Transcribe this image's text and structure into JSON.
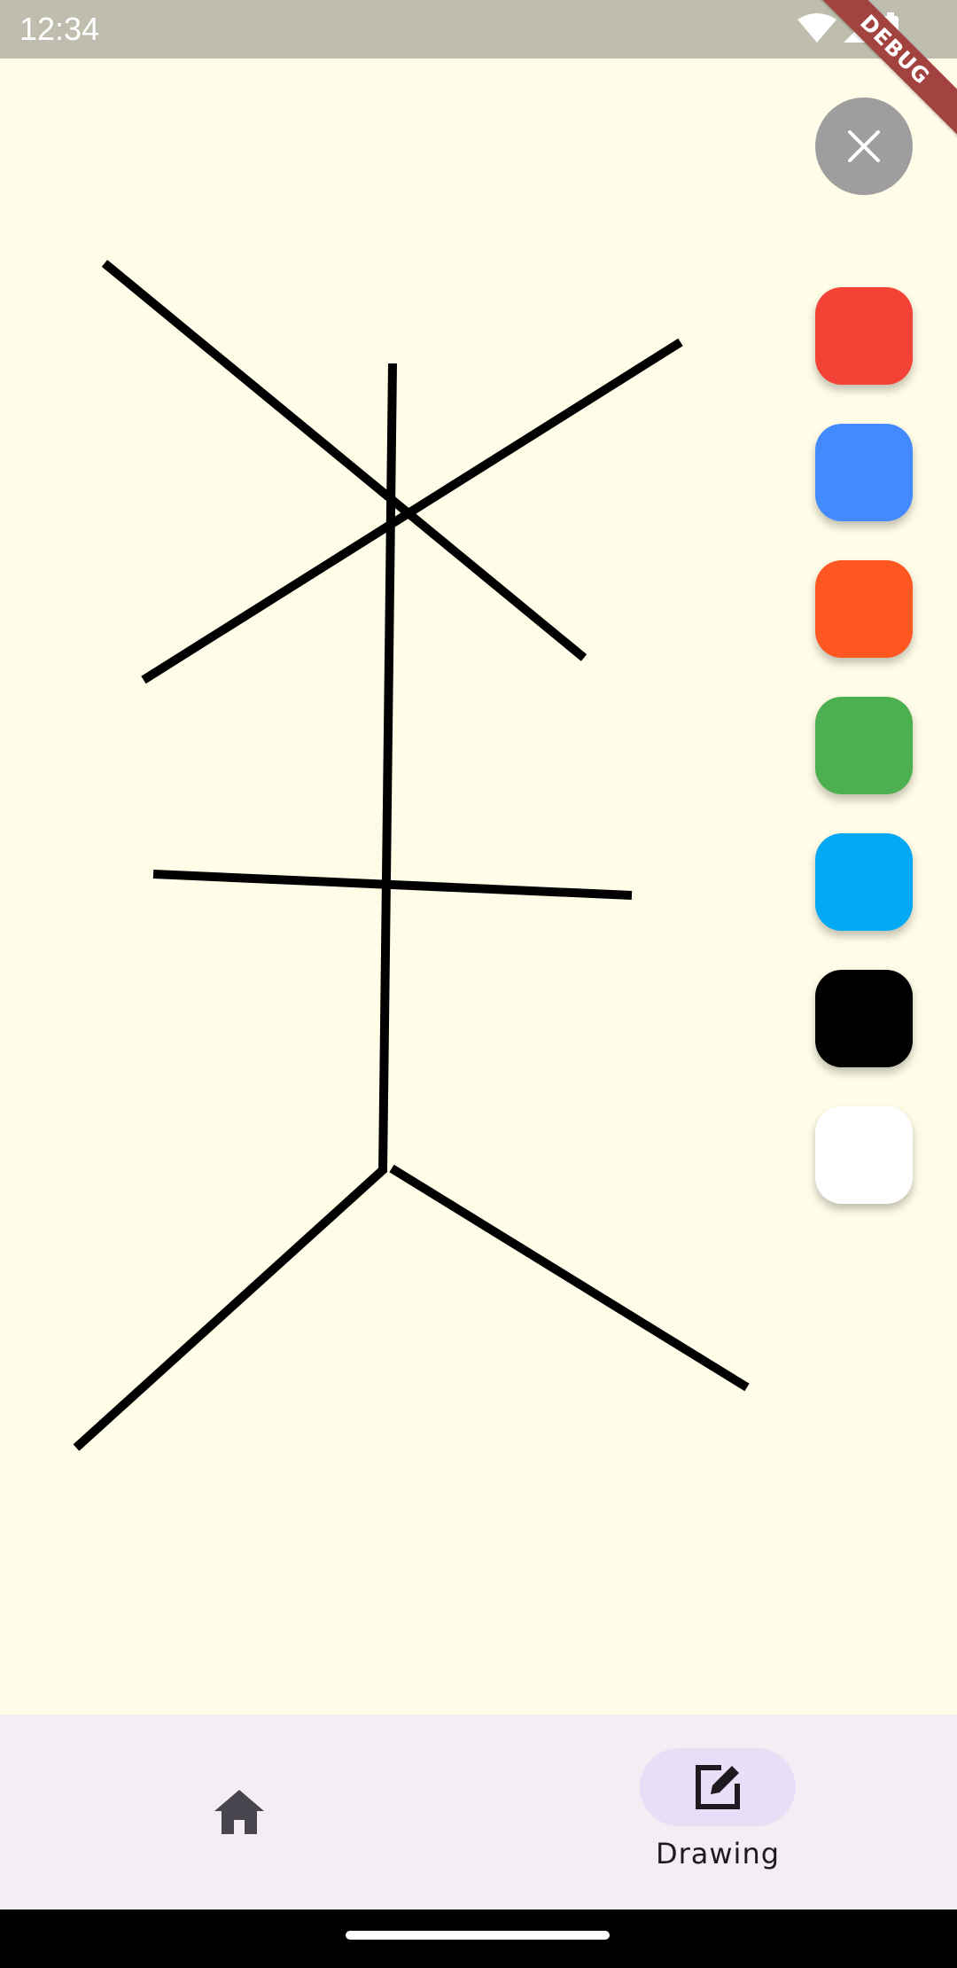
{
  "status_bar": {
    "time": "12:34",
    "icons": [
      "wifi-icon",
      "cellular-signal-icon",
      "battery-icon"
    ]
  },
  "debug_banner": {
    "label": "DEBUG"
  },
  "canvas": {
    "background": "#FFFDE7",
    "stroke_color": "#000000"
  },
  "close_button": {
    "icon": "close-icon",
    "color": "#9E9E9E"
  },
  "color_palette": {
    "swatches": [
      {
        "name": "red",
        "color": "#F44336"
      },
      {
        "name": "blue",
        "color": "#448AFF"
      },
      {
        "name": "deep-orange",
        "color": "#FF5722"
      },
      {
        "name": "green",
        "color": "#4CAF50"
      },
      {
        "name": "light-blue",
        "color": "#03A9F4"
      },
      {
        "name": "black",
        "color": "#000000"
      },
      {
        "name": "white",
        "color": "#FFFFFF"
      }
    ]
  },
  "bottom_nav": {
    "items": [
      {
        "icon": "home-icon",
        "label": "",
        "selected": false
      },
      {
        "icon": "edit-icon",
        "label": "Drawing",
        "selected": true
      }
    ],
    "indicator_color": "#E8DEF8"
  }
}
